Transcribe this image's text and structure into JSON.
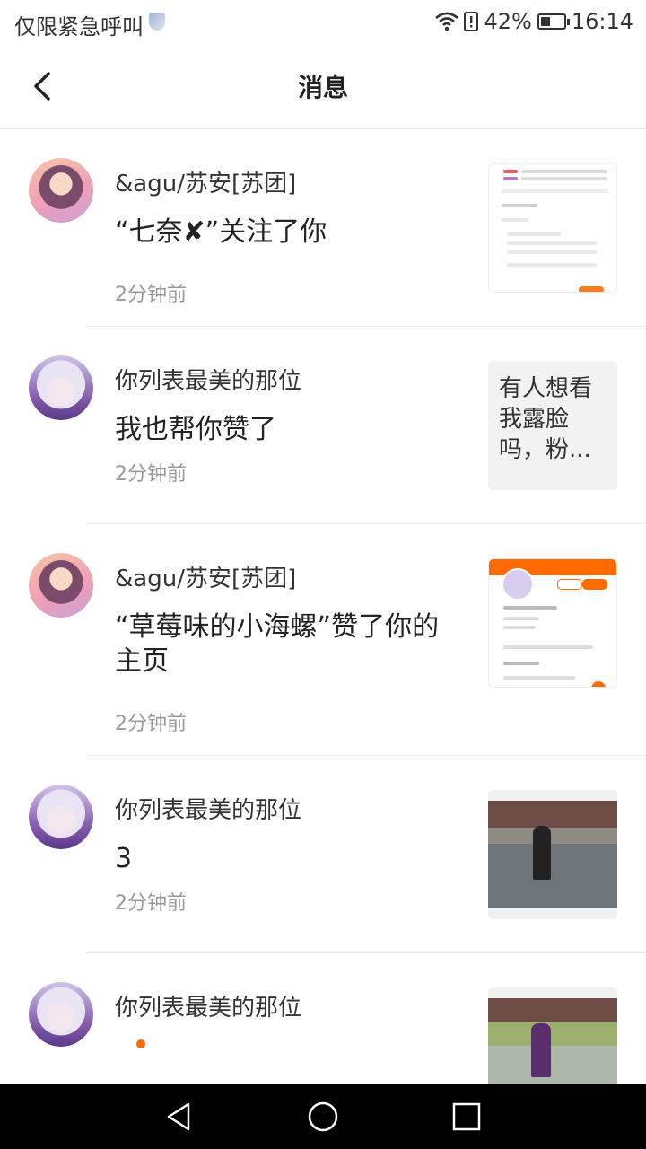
{
  "status_bar": {
    "carrier": "仅限紧急呼叫",
    "battery": "42%",
    "battery_level": 0.42,
    "time": "16:14"
  },
  "header": {
    "title": "消息"
  },
  "messages": [
    {
      "name": "&agu/苏安[苏团]",
      "text": "“七奈✘”关注了你",
      "time": "2分钟前",
      "thumb_type": "screenshot"
    },
    {
      "name": "你列表最美的那位",
      "text": "我也帮你赞了",
      "time": "2分钟前",
      "thumb_type": "text",
      "thumb_text": "有人想看我露脸吗，粉..."
    },
    {
      "name": "&agu/苏安[苏团]",
      "text": "“草莓味的小海螺”赞了你的主页",
      "time": "2分钟前",
      "thumb_type": "profile"
    },
    {
      "name": "你列表最美的那位",
      "text": "3",
      "time": "2分钟前",
      "thumb_type": "game"
    },
    {
      "name": "你列表最美的那位",
      "text": "",
      "time": "",
      "thumb_type": "game"
    }
  ],
  "icons": {
    "back": "chevron-left-icon",
    "wifi": "wifi-icon",
    "battery": "battery-icon"
  },
  "colors": {
    "accent": "#ff6a00",
    "text_secondary": "#999999"
  }
}
